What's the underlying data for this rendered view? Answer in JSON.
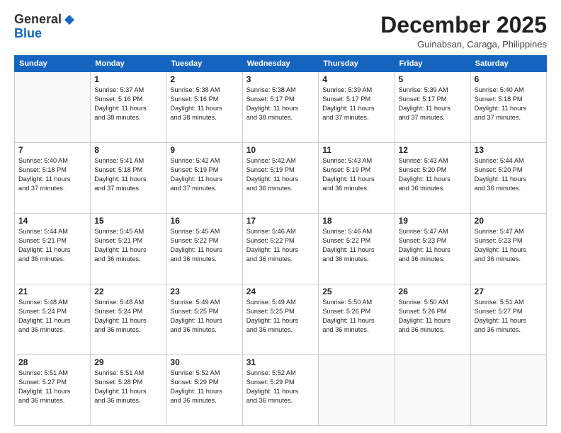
{
  "logo": {
    "general": "General",
    "blue": "Blue"
  },
  "title": "December 2025",
  "location": "Guinabsan, Caraga, Philippines",
  "days_of_week": [
    "Sunday",
    "Monday",
    "Tuesday",
    "Wednesday",
    "Thursday",
    "Friday",
    "Saturday"
  ],
  "weeks": [
    [
      {
        "day": "",
        "info": ""
      },
      {
        "day": "1",
        "info": "Sunrise: 5:37 AM\nSunset: 5:16 PM\nDaylight: 11 hours\nand 38 minutes."
      },
      {
        "day": "2",
        "info": "Sunrise: 5:38 AM\nSunset: 5:16 PM\nDaylight: 11 hours\nand 38 minutes."
      },
      {
        "day": "3",
        "info": "Sunrise: 5:38 AM\nSunset: 5:17 PM\nDaylight: 11 hours\nand 38 minutes."
      },
      {
        "day": "4",
        "info": "Sunrise: 5:39 AM\nSunset: 5:17 PM\nDaylight: 11 hours\nand 37 minutes."
      },
      {
        "day": "5",
        "info": "Sunrise: 5:39 AM\nSunset: 5:17 PM\nDaylight: 11 hours\nand 37 minutes."
      },
      {
        "day": "6",
        "info": "Sunrise: 5:40 AM\nSunset: 5:18 PM\nDaylight: 11 hours\nand 37 minutes."
      }
    ],
    [
      {
        "day": "7",
        "info": "Sunrise: 5:40 AM\nSunset: 5:18 PM\nDaylight: 11 hours\nand 37 minutes."
      },
      {
        "day": "8",
        "info": "Sunrise: 5:41 AM\nSunset: 5:18 PM\nDaylight: 11 hours\nand 37 minutes."
      },
      {
        "day": "9",
        "info": "Sunrise: 5:42 AM\nSunset: 5:19 PM\nDaylight: 11 hours\nand 37 minutes."
      },
      {
        "day": "10",
        "info": "Sunrise: 5:42 AM\nSunset: 5:19 PM\nDaylight: 11 hours\nand 36 minutes."
      },
      {
        "day": "11",
        "info": "Sunrise: 5:43 AM\nSunset: 5:19 PM\nDaylight: 11 hours\nand 36 minutes."
      },
      {
        "day": "12",
        "info": "Sunrise: 5:43 AM\nSunset: 5:20 PM\nDaylight: 11 hours\nand 36 minutes."
      },
      {
        "day": "13",
        "info": "Sunrise: 5:44 AM\nSunset: 5:20 PM\nDaylight: 11 hours\nand 36 minutes."
      }
    ],
    [
      {
        "day": "14",
        "info": "Sunrise: 5:44 AM\nSunset: 5:21 PM\nDaylight: 11 hours\nand 36 minutes."
      },
      {
        "day": "15",
        "info": "Sunrise: 5:45 AM\nSunset: 5:21 PM\nDaylight: 11 hours\nand 36 minutes."
      },
      {
        "day": "16",
        "info": "Sunrise: 5:45 AM\nSunset: 5:22 PM\nDaylight: 11 hours\nand 36 minutes."
      },
      {
        "day": "17",
        "info": "Sunrise: 5:46 AM\nSunset: 5:22 PM\nDaylight: 11 hours\nand 36 minutes."
      },
      {
        "day": "18",
        "info": "Sunrise: 5:46 AM\nSunset: 5:22 PM\nDaylight: 11 hours\nand 36 minutes."
      },
      {
        "day": "19",
        "info": "Sunrise: 5:47 AM\nSunset: 5:23 PM\nDaylight: 11 hours\nand 36 minutes."
      },
      {
        "day": "20",
        "info": "Sunrise: 5:47 AM\nSunset: 5:23 PM\nDaylight: 11 hours\nand 36 minutes."
      }
    ],
    [
      {
        "day": "21",
        "info": "Sunrise: 5:48 AM\nSunset: 5:24 PM\nDaylight: 11 hours\nand 36 minutes."
      },
      {
        "day": "22",
        "info": "Sunrise: 5:48 AM\nSunset: 5:24 PM\nDaylight: 11 hours\nand 36 minutes."
      },
      {
        "day": "23",
        "info": "Sunrise: 5:49 AM\nSunset: 5:25 PM\nDaylight: 11 hours\nand 36 minutes."
      },
      {
        "day": "24",
        "info": "Sunrise: 5:49 AM\nSunset: 5:25 PM\nDaylight: 11 hours\nand 36 minutes."
      },
      {
        "day": "25",
        "info": "Sunrise: 5:50 AM\nSunset: 5:26 PM\nDaylight: 11 hours\nand 36 minutes."
      },
      {
        "day": "26",
        "info": "Sunrise: 5:50 AM\nSunset: 5:26 PM\nDaylight: 11 hours\nand 36 minutes."
      },
      {
        "day": "27",
        "info": "Sunrise: 5:51 AM\nSunset: 5:27 PM\nDaylight: 11 hours\nand 36 minutes."
      }
    ],
    [
      {
        "day": "28",
        "info": "Sunrise: 5:51 AM\nSunset: 5:27 PM\nDaylight: 11 hours\nand 36 minutes."
      },
      {
        "day": "29",
        "info": "Sunrise: 5:51 AM\nSunset: 5:28 PM\nDaylight: 11 hours\nand 36 minutes."
      },
      {
        "day": "30",
        "info": "Sunrise: 5:52 AM\nSunset: 5:29 PM\nDaylight: 11 hours\nand 36 minutes."
      },
      {
        "day": "31",
        "info": "Sunrise: 5:52 AM\nSunset: 5:29 PM\nDaylight: 11 hours\nand 36 minutes."
      },
      {
        "day": "",
        "info": ""
      },
      {
        "day": "",
        "info": ""
      },
      {
        "day": "",
        "info": ""
      }
    ]
  ]
}
